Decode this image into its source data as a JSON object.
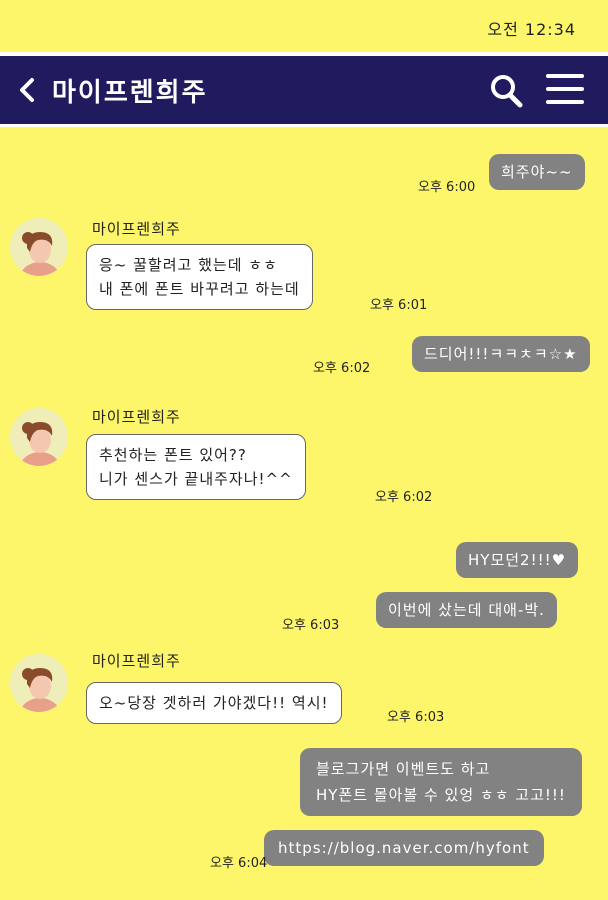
{
  "status": {
    "time": "오전 12:34"
  },
  "header": {
    "title": "마이프렌희주"
  },
  "messages": [
    {
      "from": "me",
      "text": "희주야~~",
      "time": "오후 6:00"
    },
    {
      "from": "friend",
      "sender": "마이프렌희주",
      "lines": [
        "응~ 꿀할려고 했는데 ㅎㅎ",
        "내 폰에 폰트 바꾸려고 하는데"
      ],
      "time": "오후 6:01"
    },
    {
      "from": "me",
      "text": "드디어!!!ㅋㅋㅊㅋ☆★",
      "time": "오후 6:02"
    },
    {
      "from": "friend",
      "sender": "마이프렌희주",
      "lines": [
        "추천하는 폰트 있어??",
        "니가 센스가 끝내주자나!^^"
      ],
      "time": "오후 6:02"
    },
    {
      "from": "me",
      "text": "HY모던2!!!♥",
      "time": ""
    },
    {
      "from": "me",
      "text": "이번에 샀는데 대애-박.",
      "time": "오후 6:03"
    },
    {
      "from": "friend",
      "sender": "마이프렌희주",
      "lines": [
        "오~당장 겟하러 가야겠다!! 역시!"
      ],
      "time": "오후 6:03"
    },
    {
      "from": "me",
      "lines": [
        "블로그가면 이벤트도 하고",
        "HY폰트 몰아볼 수 있엉 ㅎㅎ 고고!!!"
      ],
      "time": ""
    },
    {
      "from": "me",
      "text": "https://blog.naver.com/hyfont",
      "time": "오후 6:04"
    }
  ]
}
